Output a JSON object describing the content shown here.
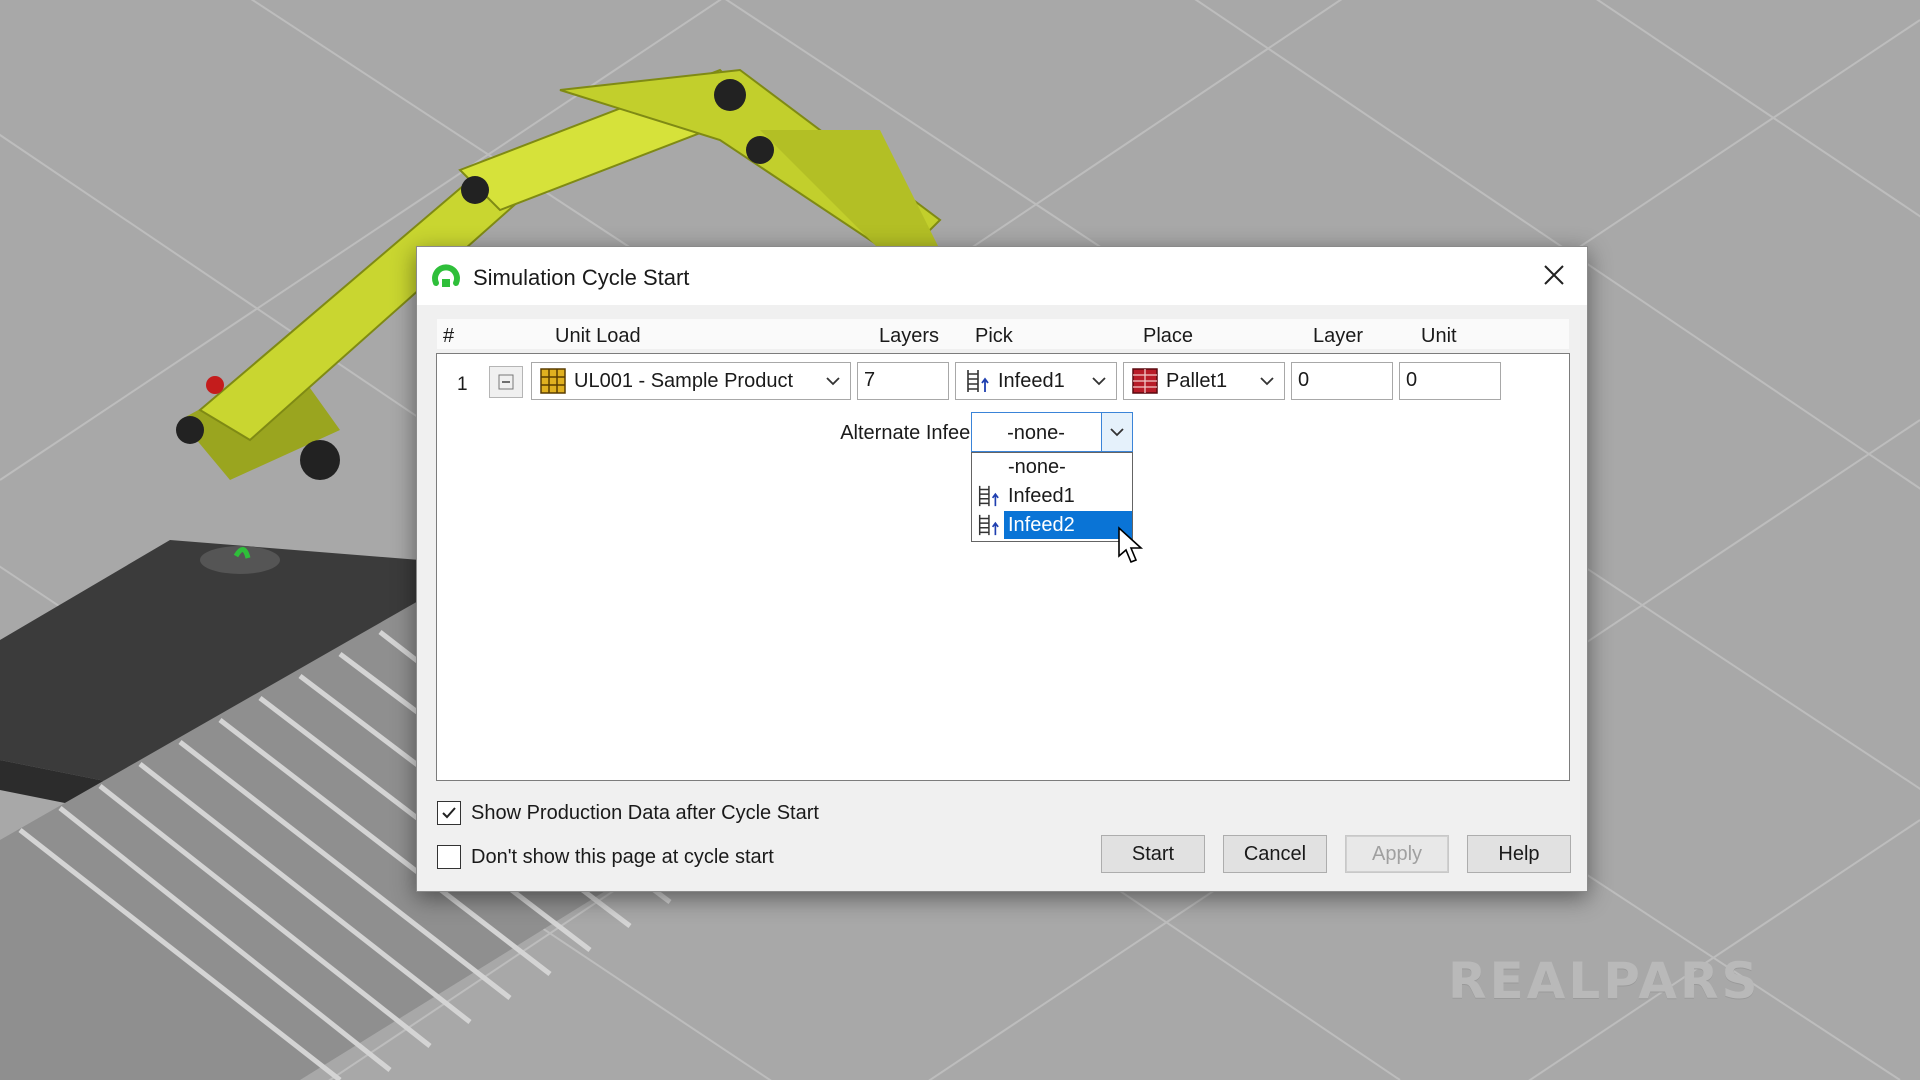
{
  "watermark": "REALPARS",
  "dialog": {
    "title": "Simulation Cycle Start",
    "close_icon": "close-icon",
    "columns": [
      "#",
      "Unit Load",
      "Layers",
      "Pick",
      "Place",
      "Layer",
      "Unit"
    ],
    "row": {
      "index": "1",
      "unit_load": "UL001 - Sample Product",
      "layers": "7",
      "pick": "Infeed1",
      "place": "Pallet1",
      "layer": "0",
      "unit": "0"
    },
    "alternate_infeeds": {
      "label": "Alternate Infeeds:",
      "value": "-none-",
      "options": [
        "-none-",
        "Infeed1",
        "Infeed2"
      ],
      "highlighted": "Infeed2"
    },
    "checkboxes": {
      "show_production_label": "Show Production Data after Cycle Start",
      "show_production_checked": true,
      "dont_show_label": "Don't show this page at cycle start",
      "dont_show_checked": false
    },
    "buttons": {
      "start": "Start",
      "cancel": "Cancel",
      "apply": "Apply",
      "help": "Help"
    }
  },
  "colors": {
    "robot": "#c9d630",
    "selection": "#0a74d6",
    "app_icon": "#2fbf3a"
  }
}
